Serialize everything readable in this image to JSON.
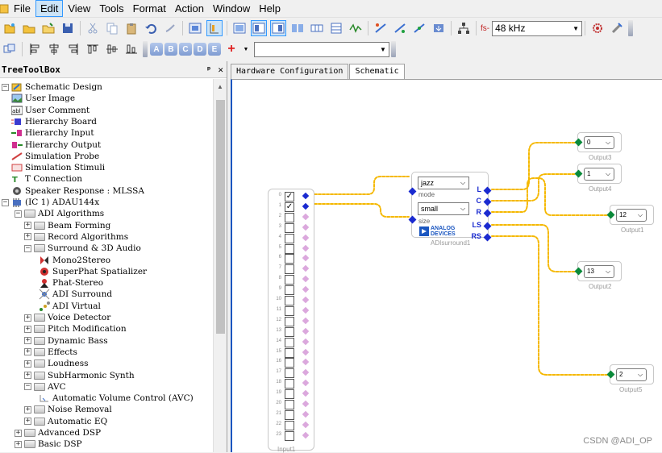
{
  "menu": {
    "items": [
      "File",
      "Edit",
      "View",
      "Tools",
      "Format",
      "Action",
      "Window",
      "Help"
    ],
    "active": "Edit"
  },
  "toolbar": {
    "sample_rate_label": "fs-",
    "sample_rate_value": "48 kHz"
  },
  "toolbox": {
    "title": "TreeToolBox",
    "pin_label": "ᵖ",
    "close_label": "✕",
    "items": [
      {
        "label": "Schematic Design",
        "icon": "schematic-icon",
        "exp": "−"
      },
      {
        "label": "User Image",
        "icon": "user-image-icon"
      },
      {
        "label": "User Comment",
        "icon": "user-comment-icon"
      },
      {
        "label": "Hierarchy Board",
        "icon": "hierarchy-board-icon"
      },
      {
        "label": "Hierarchy Input",
        "icon": "hierarchy-input-icon"
      },
      {
        "label": "Hierarchy Output",
        "icon": "hierarchy-output-icon"
      },
      {
        "label": "Simulation Probe",
        "icon": "simulation-probe-icon"
      },
      {
        "label": "Simulation Stimuli",
        "icon": "simulation-stimuli-icon"
      },
      {
        "label": "T Connection",
        "icon": "t-connection-icon"
      },
      {
        "label": "Speaker Response : MLSSA",
        "icon": "speaker-response-icon"
      },
      {
        "label": "(IC 1) ADAU144x",
        "icon": "ic-chip-icon",
        "exp": "−"
      },
      {
        "label": "ADI Algorithms",
        "icon": "folder-icon",
        "exp": "−"
      },
      {
        "label": "Beam Forming",
        "icon": "folder-icon",
        "exp": "+"
      },
      {
        "label": "Record Algorithms",
        "icon": "folder-icon",
        "exp": "+"
      },
      {
        "label": "Surround & 3D Audio",
        "icon": "folder-icon",
        "exp": "−"
      },
      {
        "label": "Mono2Stereo",
        "icon": "mono2stereo-icon"
      },
      {
        "label": "SuperPhat Spatializer",
        "icon": "superphat-icon"
      },
      {
        "label": "Phat-Stereo",
        "icon": "phat-stereo-icon"
      },
      {
        "label": "ADI Surround",
        "icon": "adi-surround-icon"
      },
      {
        "label": "ADI Virtual",
        "icon": "adi-virtual-icon"
      },
      {
        "label": "Voice Detector",
        "icon": "folder-icon",
        "exp": "+"
      },
      {
        "label": "Pitch Modification",
        "icon": "folder-icon",
        "exp": "+"
      },
      {
        "label": "Dynamic Bass",
        "icon": "folder-icon",
        "exp": "+"
      },
      {
        "label": "Effects",
        "icon": "folder-icon",
        "exp": "+"
      },
      {
        "label": "Loudness",
        "icon": "folder-icon",
        "exp": "+"
      },
      {
        "label": "SubHarmonic Synth",
        "icon": "folder-icon",
        "exp": "+"
      },
      {
        "label": "AVC",
        "icon": "folder-icon",
        "exp": "−"
      },
      {
        "label": "Automatic Volume Control (AVC)",
        "icon": "avc-icon"
      },
      {
        "label": "Noise Removal",
        "icon": "folder-icon",
        "exp": "+"
      },
      {
        "label": "Automatic EQ",
        "icon": "folder-icon",
        "exp": "+"
      },
      {
        "label": "Advanced DSP",
        "icon": "folder-icon",
        "exp": "+"
      },
      {
        "label": "Basic DSP",
        "icon": "folder-icon",
        "exp": "+"
      }
    ]
  },
  "tabs": [
    {
      "label": "Hardware Configuration",
      "active": false
    },
    {
      "label": "Schematic",
      "active": true
    }
  ],
  "schematic": {
    "input_block": {
      "label": "Input1",
      "channels": [
        "0",
        "1",
        "2",
        "3",
        "4",
        "5",
        "6",
        "7",
        "8",
        "9",
        "10",
        "11",
        "12",
        "13",
        "14",
        "15",
        "16",
        "17",
        "18",
        "19",
        "20",
        "21",
        "22",
        "23"
      ],
      "checked": [
        true,
        true,
        false,
        false,
        false,
        false,
        false,
        false,
        false,
        false,
        false,
        false,
        false,
        false,
        false,
        false,
        false,
        false,
        false,
        false,
        false,
        false,
        false,
        false
      ]
    },
    "surround_block": {
      "label": "ADIsurround1",
      "mode_value": "jazz",
      "mode_label": "mode",
      "size_value": "small",
      "size_label": "size",
      "outputs": [
        "L",
        "C",
        "R",
        "LS",
        "RS"
      ],
      "logo_line1": "ANALOG",
      "logo_line2": "DEVICES"
    },
    "outputs": [
      {
        "label": "Output3",
        "value": "0"
      },
      {
        "label": "Output4",
        "value": "1"
      },
      {
        "label": "Output1",
        "value": "12"
      },
      {
        "label": "Output2",
        "value": "13"
      },
      {
        "label": "Output5",
        "value": "2"
      }
    ],
    "wire_color": "#f5b800"
  },
  "watermark": "CSDN @ADI_OP"
}
